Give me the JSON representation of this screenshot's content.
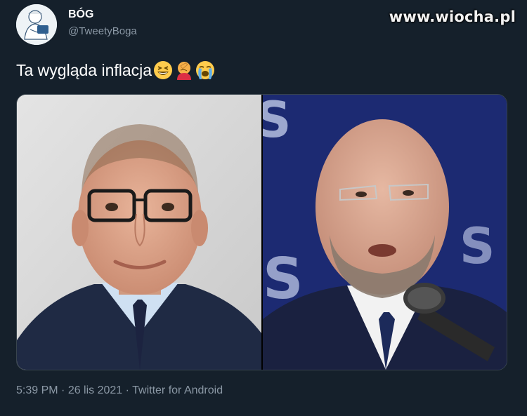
{
  "watermark": "www.wiocha.pl",
  "author": {
    "display_name": "BÓG",
    "handle": "@TweetyBoga",
    "avatar_icon": "avatar-illustration-icon"
  },
  "tweet": {
    "text": "Ta wygląda inflacja",
    "emojis": [
      "grinning-squinting-face-icon",
      "person-facepalming-icon",
      "loudly-crying-face-icon"
    ]
  },
  "media": {
    "photos": [
      "photo-man-glasses-suit",
      "photo-man-microphone-beard"
    ]
  },
  "meta": {
    "time": "5:39 PM",
    "separator": " · ",
    "date": "26 lis 2021",
    "client": "Twitter for Android"
  },
  "colors": {
    "background": "#15202b",
    "secondary_text": "#8b98a5",
    "border": "#38444d"
  }
}
